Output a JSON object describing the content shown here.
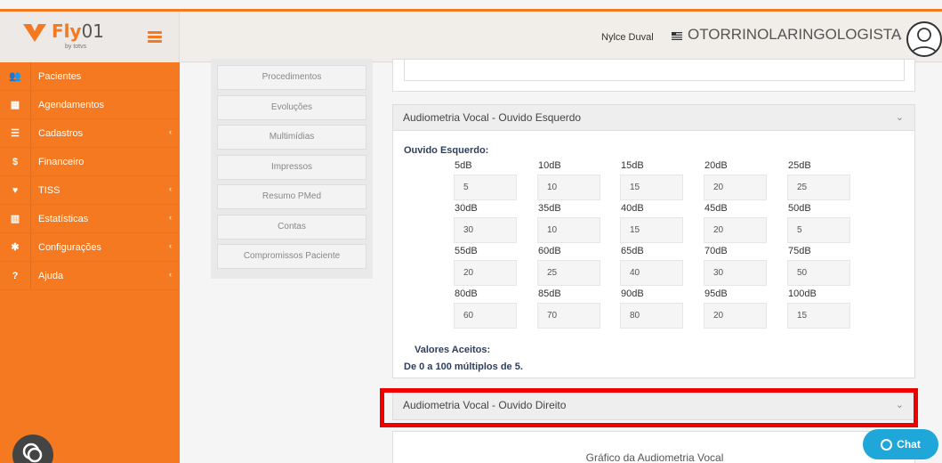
{
  "brand": {
    "name_bold": "Fly",
    "name_thin": "01",
    "by_text": "by totvs"
  },
  "sidebar": {
    "items": [
      {
        "icon": "users-icon",
        "glyph": "👥",
        "label": "Pacientes",
        "has_children": false
      },
      {
        "icon": "calendar-icon",
        "glyph": "▦",
        "label": "Agendamentos",
        "has_children": false
      },
      {
        "icon": "list-icon",
        "glyph": "☰",
        "label": "Cadastros",
        "has_children": true
      },
      {
        "icon": "dollar-icon",
        "glyph": "$",
        "label": "Financeiro",
        "has_children": false
      },
      {
        "icon": "heartbeat-icon",
        "glyph": "♥",
        "label": "TISS",
        "has_children": true
      },
      {
        "icon": "bar-chart-icon",
        "glyph": "▥",
        "label": "Estatísticas",
        "has_children": true
      },
      {
        "icon": "gear-icon",
        "glyph": "✱",
        "label": "Configurações",
        "has_children": true
      },
      {
        "icon": "question-icon",
        "glyph": "?",
        "label": "Ajuda",
        "has_children": true
      }
    ],
    "chevron": "‹"
  },
  "header": {
    "user_name": "Nylce Duval",
    "specialty": "OTORRINOLARINGOLOGISTA",
    "specialty_chevron": "⌄"
  },
  "tabs": [
    "Procedimentos",
    "Evoluções",
    "Multimídias",
    "Impressos",
    "Resumo PMed",
    "Contas",
    "Compromissos Paciente"
  ],
  "panel_left": {
    "title": "Audiometria Vocal - Ouvido Esquerdo",
    "chevron": "⌄",
    "field_title": "Ouvido Esquerdo:",
    "rows": [
      {
        "labels": [
          "5dB",
          "10dB",
          "15dB",
          "20dB",
          "25dB"
        ],
        "values": [
          "5",
          "10",
          "15",
          "20",
          "25"
        ]
      },
      {
        "labels": [
          "30dB",
          "35dB",
          "40dB",
          "45dB",
          "50dB"
        ],
        "values": [
          "30",
          "10",
          "15",
          "20",
          "5"
        ]
      },
      {
        "labels": [
          "55dB",
          "60dB",
          "65dB",
          "70dB",
          "75dB"
        ],
        "values": [
          "20",
          "25",
          "40",
          "30",
          "50"
        ]
      },
      {
        "labels": [
          "80dB",
          "85dB",
          "90dB",
          "95dB",
          "100dB"
        ],
        "values": [
          "60",
          "70",
          "80",
          "20",
          "15"
        ]
      }
    ],
    "accepted_title": "Valores Aceitos:",
    "accepted_text": "De 0 a 100 múltiplos de 5."
  },
  "panel_right": {
    "title": "Audiometria Vocal - Ouvido Direito",
    "chevron": "⌄"
  },
  "chart_section": {
    "title": "Gráfico da Audiometria Vocal"
  },
  "chat": {
    "label": "Chat"
  },
  "colors": {
    "brand_orange": "#f47920",
    "chat_blue": "#1ea7d8",
    "highlight_red": "#ee0000"
  }
}
